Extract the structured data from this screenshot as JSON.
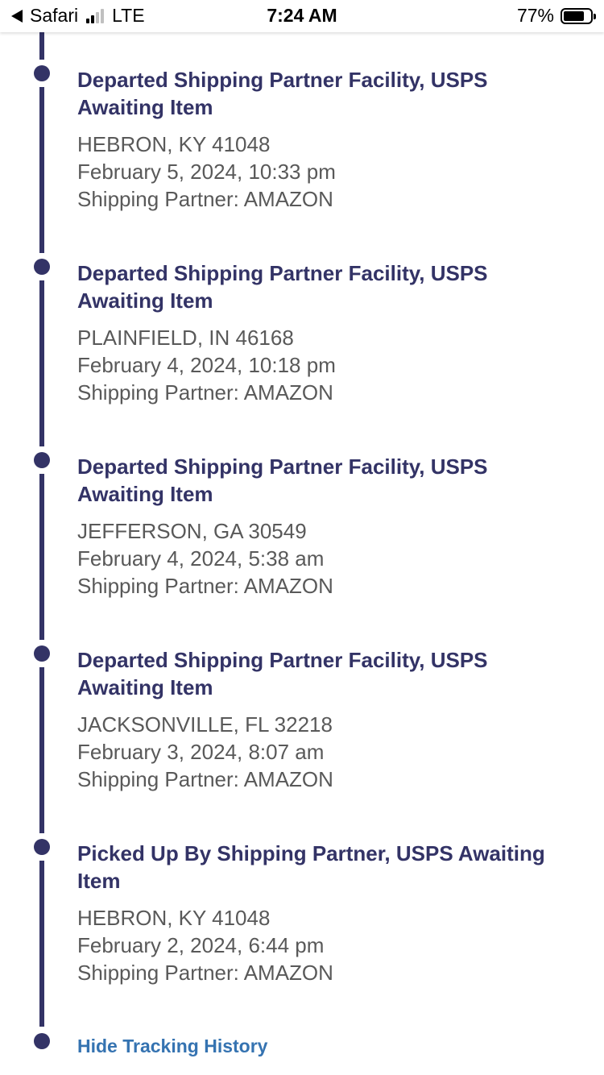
{
  "status_bar": {
    "back_app": "Safari",
    "carrier": "LTE",
    "time": "7:24 AM",
    "battery_percent": "77%",
    "battery_level": 0.77,
    "signal_bars_active": 2,
    "signal_bars_total": 4
  },
  "colors": {
    "timeline": "#333366",
    "title": "#333366",
    "detail": "#595959",
    "link": "#3573b1"
  },
  "events": [
    {
      "title_line1": "Departed Shipping Partner Facility, USPS",
      "title_line2": "Awaiting Item",
      "location": "HEBRON, KY 41048",
      "datetime": "February 5, 2024, 10:33 pm",
      "partner": "Shipping Partner: AMAZON"
    },
    {
      "title_line1": "Departed Shipping Partner Facility, USPS",
      "title_line2": "Awaiting Item",
      "location": "PLAINFIELD, IN 46168",
      "datetime": "February 4, 2024, 10:18 pm",
      "partner": "Shipping Partner: AMAZON"
    },
    {
      "title_line1": "Departed Shipping Partner Facility, USPS",
      "title_line2": "Awaiting Item",
      "location": "JEFFERSON, GA 30549",
      "datetime": "February 4, 2024, 5:38 am",
      "partner": "Shipping Partner: AMAZON"
    },
    {
      "title_line1": "Departed Shipping Partner Facility, USPS",
      "title_line2": "Awaiting Item",
      "location": "JACKSONVILLE, FL 32218",
      "datetime": "February 3, 2024, 8:07 am",
      "partner": "Shipping Partner: AMAZON"
    },
    {
      "title_line1": "Picked Up By Shipping Partner, USPS Awaiting",
      "title_line2": "Item",
      "location": "HEBRON, KY 41048",
      "datetime": "February 2, 2024, 6:44 pm",
      "partner": "Shipping Partner: AMAZON"
    }
  ],
  "hide_tracking_label": "Hide Tracking History"
}
